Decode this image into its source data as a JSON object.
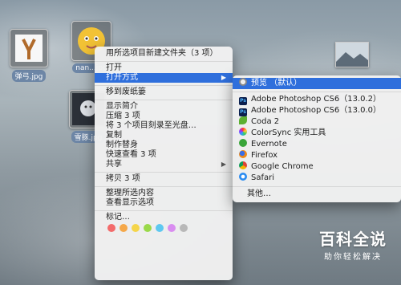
{
  "desktop": {
    "files": [
      {
        "name": "弹弓.jpg"
      },
      {
        "name": "nan...jpg"
      },
      {
        "name": "雪豚.jpg"
      }
    ]
  },
  "context_menu": {
    "items": [
      {
        "label": "用所选项目新建文件夹（3 项）"
      },
      {
        "label": "打开"
      },
      {
        "label": "打开方式"
      },
      {
        "label": "移到废纸篓"
      },
      {
        "label": "显示简介"
      },
      {
        "label": "压缩 3 项"
      },
      {
        "label": "将 3 个项目刻录至光盘…"
      },
      {
        "label": "复制"
      },
      {
        "label": "制作替身"
      },
      {
        "label": "快速查看 3 项"
      },
      {
        "label": "共享"
      },
      {
        "label": "拷贝 3 项"
      },
      {
        "label": "整理所选内容"
      },
      {
        "label": "查看显示选项"
      },
      {
        "label": "标记…"
      }
    ],
    "tag_colors": [
      "#f36b6b",
      "#f5a84a",
      "#f5d54a",
      "#9ad94a",
      "#5ec8f0",
      "#d98df0",
      "#b8b8b8"
    ]
  },
  "open_with_menu": {
    "items": [
      {
        "label": "预览 （默认）",
        "icon": "preview-icon"
      },
      {
        "label": "Adobe Photoshop CS6（13.0.2）",
        "icon": "photoshop-icon"
      },
      {
        "label": "Adobe Photoshop CS6（13.0.0）",
        "icon": "photoshop-icon"
      },
      {
        "label": "Coda 2",
        "icon": "coda-icon"
      },
      {
        "label": "ColorSync 实用工具",
        "icon": "colorsync-icon"
      },
      {
        "label": "Evernote",
        "icon": "evernote-icon"
      },
      {
        "label": "Firefox",
        "icon": "firefox-icon"
      },
      {
        "label": "Google Chrome",
        "icon": "chrome-icon"
      },
      {
        "label": "Safari",
        "icon": "safari-icon"
      },
      {
        "label": "其他…"
      }
    ]
  },
  "watermark": {
    "title": "百科全说",
    "subtitle": "助你轻松解决"
  }
}
